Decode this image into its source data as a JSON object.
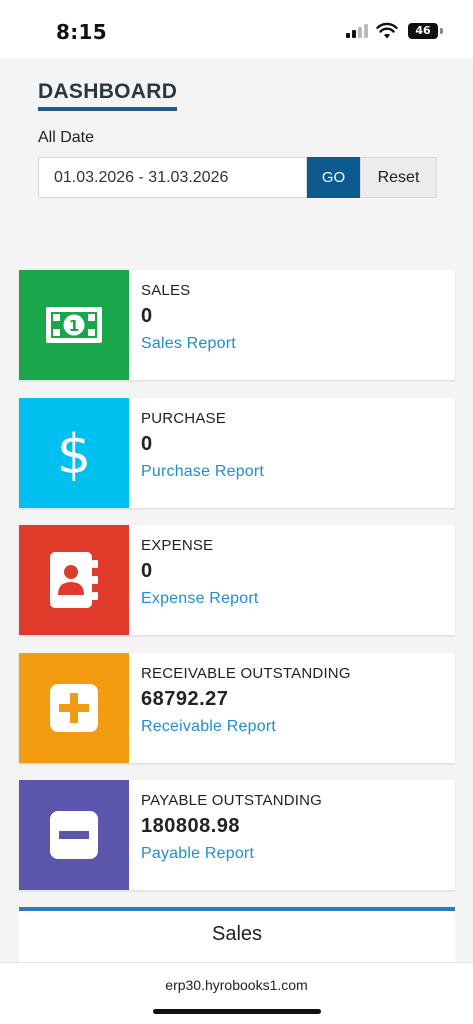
{
  "status_bar": {
    "time": "8:15",
    "battery": "46"
  },
  "page": {
    "title": "DASHBOARD",
    "date_label": "All Date",
    "date_range_value": "01.03.2026 - 31.03.2026",
    "go_label": "GO",
    "reset_label": "Reset"
  },
  "cards": [
    {
      "title": "SALES",
      "value": "0",
      "link": "Sales Report",
      "color": "#1aa64a",
      "icon": "banknote-icon"
    },
    {
      "title": "PURCHASE",
      "value": "0",
      "link": "Purchase Report",
      "color": "#00c0ef",
      "icon": "dollar-icon"
    },
    {
      "title": "EXPENSE",
      "value": "0",
      "link": "Expense Report",
      "color": "#e03a2b",
      "icon": "contact-book-icon"
    },
    {
      "title": "RECEIVABLE OUTSTANDING",
      "value": "68792.27",
      "link": "Receivable Report",
      "color": "#f39c12",
      "icon": "plus-square-icon"
    },
    {
      "title": "PAYABLE OUTSTANDING",
      "value": "180808.98",
      "link": "Payable Report",
      "color": "#5b55ab",
      "icon": "minus-square-icon"
    }
  ],
  "sales_panel": {
    "title": "Sales"
  },
  "browser": {
    "url": "erp30.hyrobooks1.com"
  }
}
